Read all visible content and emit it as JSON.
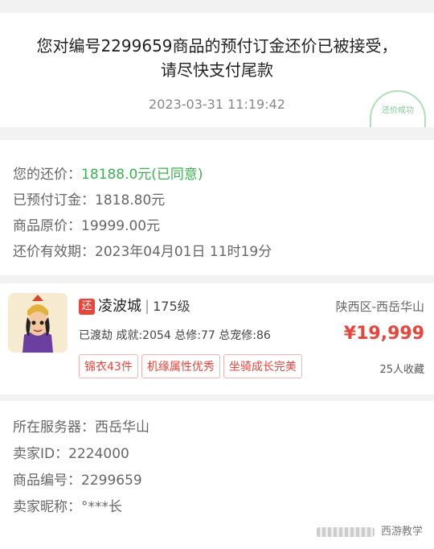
{
  "notice": {
    "headline_line1": "您对编号2299659商品的预付订金还价已被接受，",
    "headline_line2": "请尽快支付尾款",
    "timestamp": "2023-03-31 11:19:42",
    "stamp_text": "还价成功"
  },
  "offer": {
    "bid_label": "您的还价：",
    "bid_value": "18188.0元(已同意)",
    "deposit_label": "已预付订金：",
    "deposit_value": "1818.80元",
    "original_label": "商品原价：",
    "original_value": "19999.00元",
    "validity_label": "还价有效期：",
    "validity_value": "2023年04月01日 11时19分"
  },
  "item": {
    "badge": "还",
    "name": "凌波城",
    "level": "175级",
    "region": "陕西区-西岳华山",
    "stats": "已渡劫 成就:2054 总修:77 总宠修:86",
    "price": "¥19,999",
    "tags": [
      "锦衣43件",
      "机缘属性优秀",
      "坐骑成长完美"
    ],
    "favorites": "25人收藏"
  },
  "seller": {
    "server_label": "所在服务器：",
    "server_value": "西岳华山",
    "id_label": "卖家ID：",
    "id_value": "2224000",
    "item_no_label": "商品编号：",
    "item_no_value": "2299659",
    "nickname_label": "卖家昵称：",
    "nickname_value": "°***长"
  },
  "watermark": "西游教学",
  "colors": {
    "accent_red": "#e8453c",
    "accent_green": "#3fae55"
  }
}
